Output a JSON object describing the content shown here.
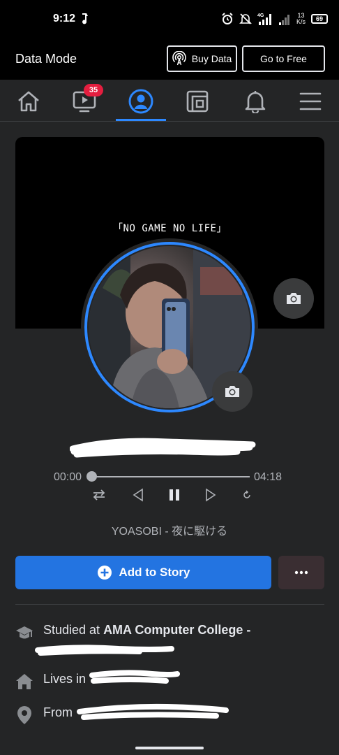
{
  "status_bar": {
    "time": "9:12",
    "network": "4G",
    "speed_value": "13",
    "speed_unit": "K/s",
    "battery": "69"
  },
  "data_bar": {
    "title": "Data Mode",
    "buy_data_label": "Buy Data",
    "go_free_label": "Go to Free"
  },
  "nav": {
    "items": [
      "home-icon",
      "watch-icon",
      "profile-icon",
      "feeds-icon",
      "bell-icon",
      "menu-icon"
    ],
    "watch_badge": "35",
    "active_index": 2
  },
  "cover": {
    "text": "「NO GAME NO LIFE」"
  },
  "player": {
    "current_time": "00:00",
    "total_time": "04:18",
    "progress": 0,
    "song": "YOASOBI - 夜に駆ける"
  },
  "actions": {
    "add_story_label": "Add to Story",
    "more_label": "•••"
  },
  "intro": {
    "studied_prefix": "Studied at ",
    "studied_school": "AMA Computer College -",
    "lives_prefix": "Lives in",
    "from_prefix": "From"
  },
  "colors": {
    "accent": "#2d88ff",
    "button_blue": "#2374e1",
    "badge_red": "#e41e3f",
    "background": "#242526"
  }
}
